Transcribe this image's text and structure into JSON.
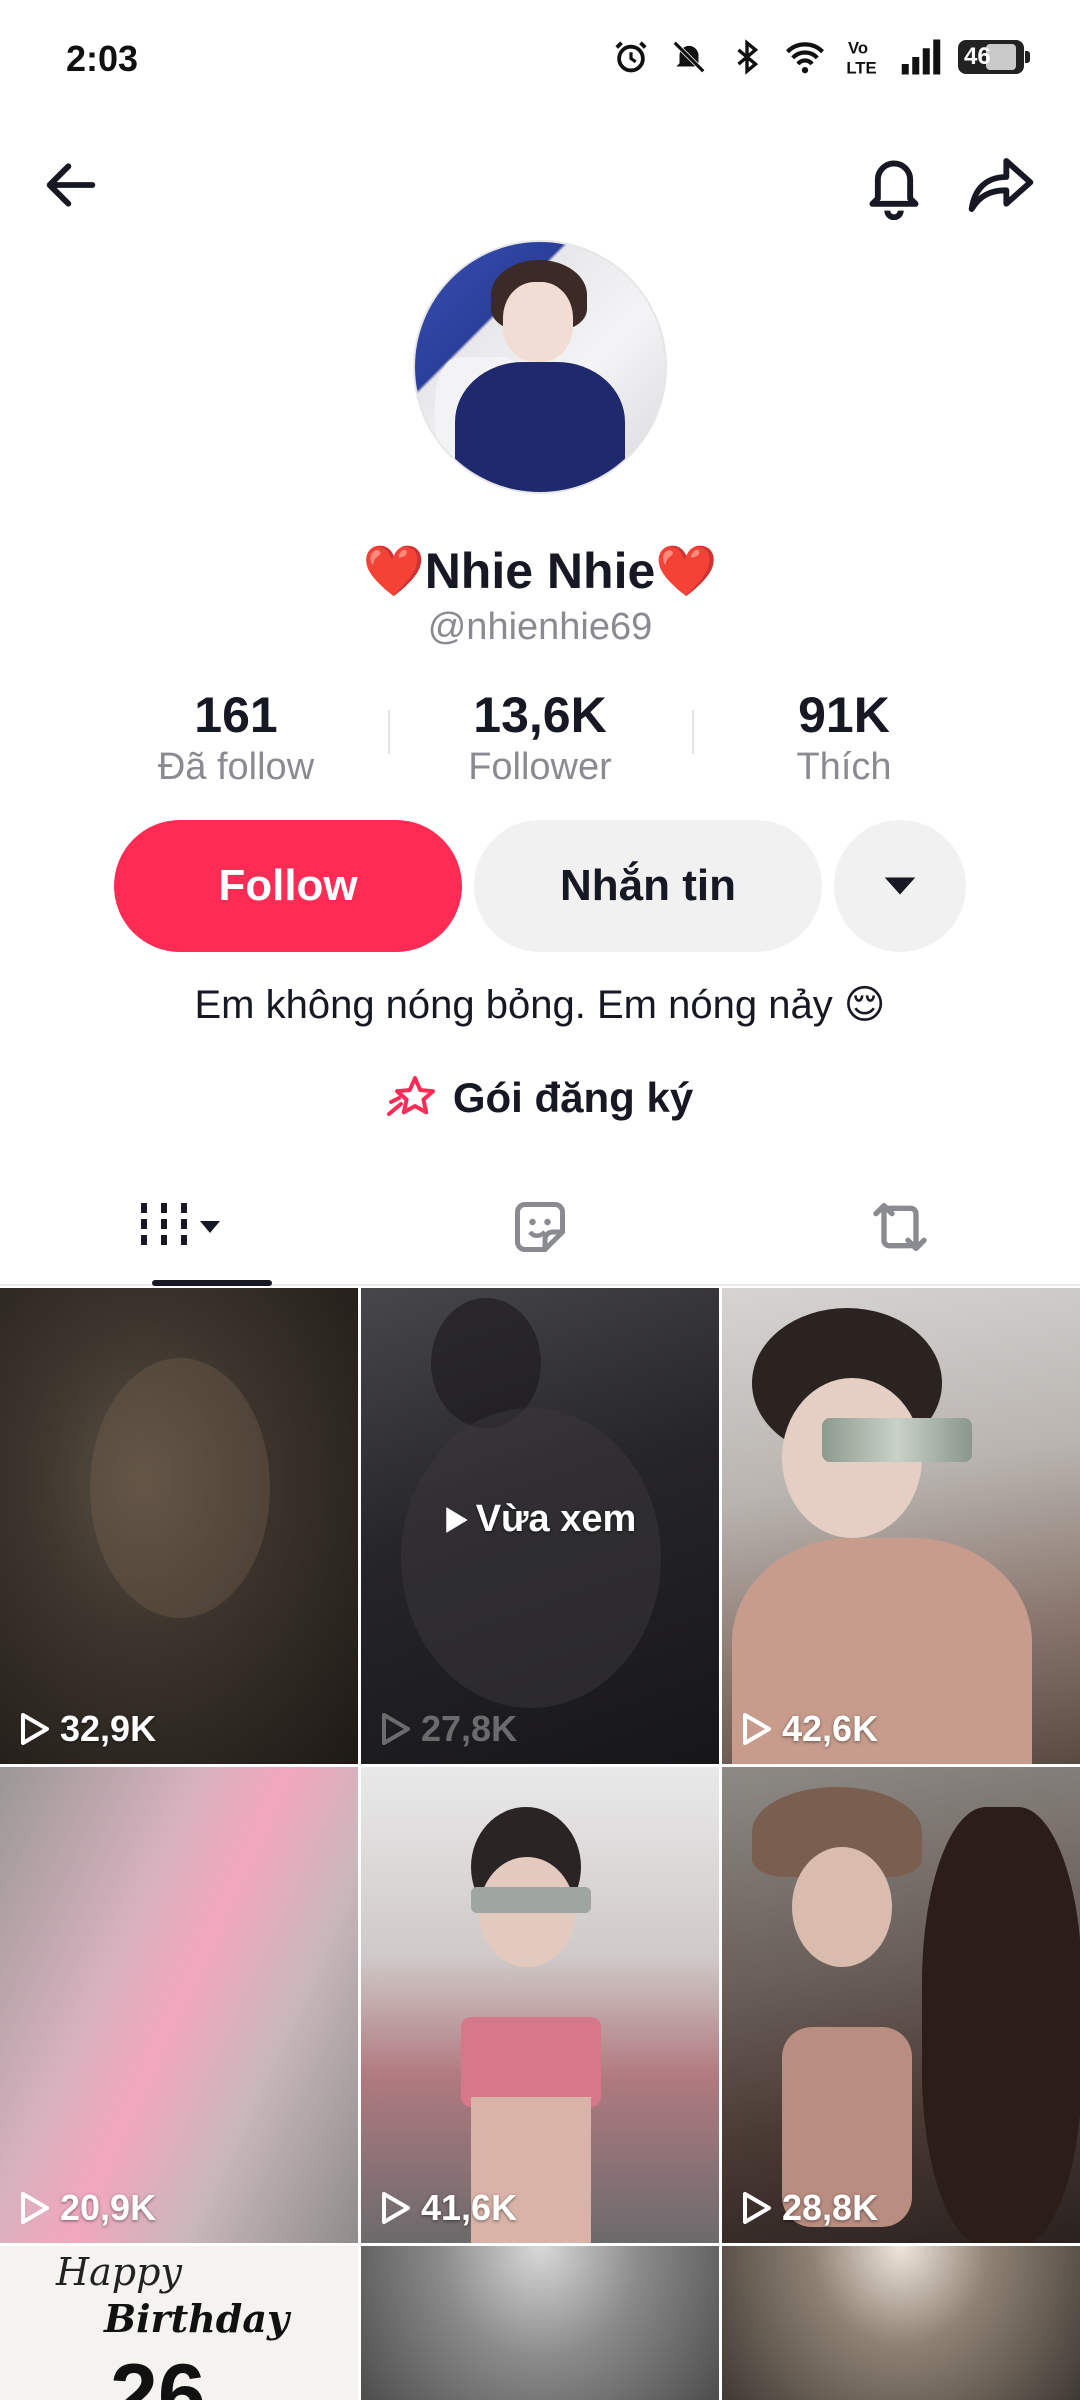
{
  "status_bar": {
    "time": "2:03",
    "icons": [
      "alarm-icon",
      "mute-bell-icon",
      "bluetooth-icon",
      "wifi-icon",
      "volte-icon",
      "signal-icon"
    ],
    "battery": "46"
  },
  "nav": {
    "back_icon": "arrow-left-icon",
    "bell_icon": "bell-icon",
    "share_icon": "share-icon"
  },
  "profile": {
    "name": "❤️Nhie Nhie❤️",
    "handle": "@nhienhie69",
    "bio": "Em không nóng bỏng. Em nóng nảy 😌",
    "subscription": "Gói đăng ký"
  },
  "stats": [
    {
      "value": "161",
      "label": "Đã follow"
    },
    {
      "value": "13,6K",
      "label": "Follower"
    },
    {
      "value": "91K",
      "label": "Thích"
    }
  ],
  "actions": {
    "follow": "Follow",
    "message": "Nhắn tin"
  },
  "tabs": [
    "videos-grid-icon",
    "liked-sticker-icon",
    "repost-icon"
  ],
  "videos": [
    {
      "views": "32,9K"
    },
    {
      "views": "27,8K",
      "badge": "Vừa xem"
    },
    {
      "views": "42,6K"
    },
    {
      "views": "20,9K"
    },
    {
      "views": "41,6K"
    },
    {
      "views": "28,8K"
    }
  ],
  "bottom_thumb": {
    "line1": "Happy",
    "line2": "Birthday",
    "line3": "26"
  },
  "colors": {
    "accent": "#fe2c55",
    "text": "#161823",
    "muted": "#8a8b91"
  }
}
